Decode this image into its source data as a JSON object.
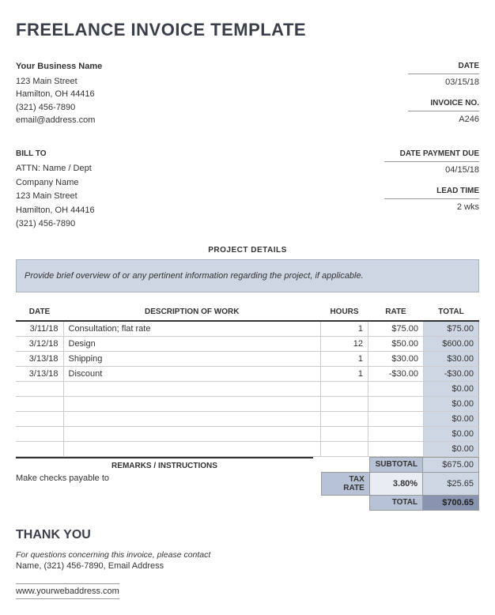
{
  "title": "FREELANCE INVOICE TEMPLATE",
  "from": {
    "name": "Your Business Name",
    "street": "123 Main Street",
    "citystate": "Hamilton, OH 44416",
    "phone": "(321) 456-7890",
    "email": "email@address.com"
  },
  "meta": {
    "date_label": "DATE",
    "date_value": "03/15/18",
    "invoice_label": "INVOICE NO.",
    "invoice_value": "A246",
    "due_label": "DATE PAYMENT DUE",
    "due_value": "04/15/18",
    "lead_label": "LEAD TIME",
    "lead_value": "2 wks"
  },
  "billto": {
    "title": "BILL TO",
    "attn": "ATTN: Name / Dept",
    "company": "Company Name",
    "street": "123 Main Street",
    "citystate": "Hamilton, OH 44416",
    "phone": "(321) 456-7890"
  },
  "project": {
    "heading": "PROJECT DETAILS",
    "text": "Provide brief overview of or any pertinent information regarding the project, if applicable."
  },
  "columns": {
    "date": "DATE",
    "desc": "DESCRIPTION OF WORK",
    "hours": "HOURS",
    "rate": "RATE",
    "total": "TOTAL"
  },
  "rows": [
    {
      "date": "3/11/18",
      "desc": "Consultation; flat rate",
      "hours": "1",
      "rate": "$75.00",
      "total": "$75.00"
    },
    {
      "date": "3/12/18",
      "desc": "Design",
      "hours": "12",
      "rate": "$50.00",
      "total": "$600.00"
    },
    {
      "date": "3/13/18",
      "desc": "Shipping",
      "hours": "1",
      "rate": "$30.00",
      "total": "$30.00"
    },
    {
      "date": "3/13/18",
      "desc": "Discount",
      "hours": "1",
      "rate": "-$30.00",
      "total": "-$30.00"
    },
    {
      "date": "",
      "desc": "",
      "hours": "",
      "rate": "",
      "total": "$0.00"
    },
    {
      "date": "",
      "desc": "",
      "hours": "",
      "rate": "",
      "total": "$0.00"
    },
    {
      "date": "",
      "desc": "",
      "hours": "",
      "rate": "",
      "total": "$0.00"
    },
    {
      "date": "",
      "desc": "",
      "hours": "",
      "rate": "",
      "total": "$0.00"
    },
    {
      "date": "",
      "desc": "",
      "hours": "",
      "rate": "",
      "total": "$0.00"
    }
  ],
  "remarks": {
    "title": "REMARKS / INSTRUCTIONS",
    "text": "Make checks payable to"
  },
  "totals": {
    "subtotal_label": "SUBTOTAL",
    "subtotal_value": "$675.00",
    "taxrate_label": "TAX RATE",
    "taxrate_mid": "3.80%",
    "taxrate_value": "$25.65",
    "total_label": "TOTAL",
    "total_value": "$700.65"
  },
  "footer": {
    "thankyou": "THANK YOU",
    "contact_note": "For questions concerning this invoice, please contact",
    "contact_line": "Name, (321) 456-7890, Email Address",
    "web": "www.yourwebaddress.com"
  }
}
